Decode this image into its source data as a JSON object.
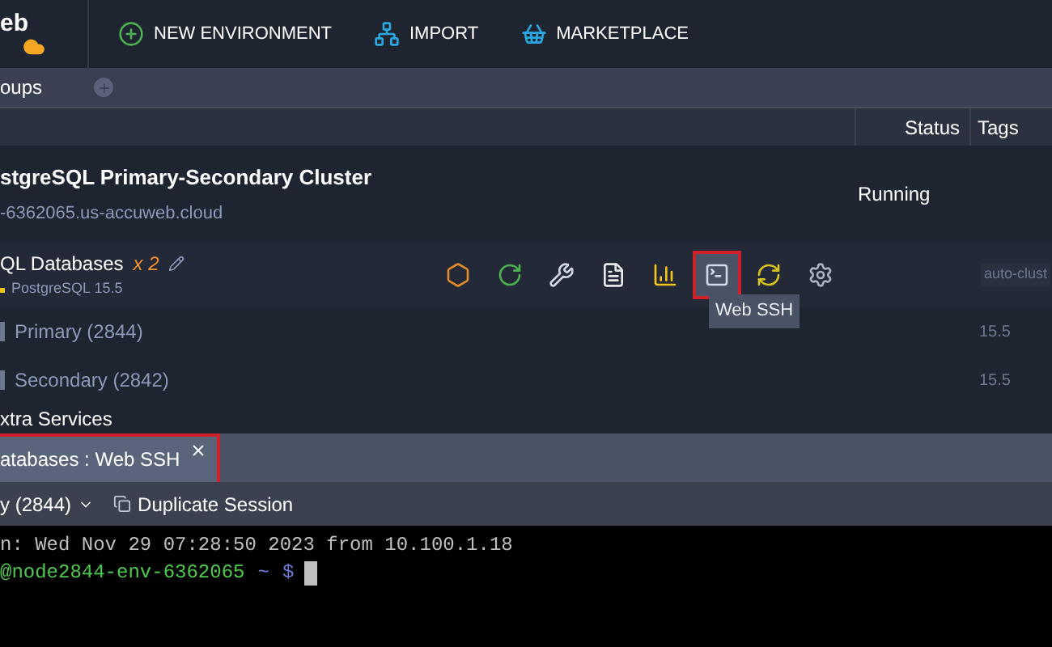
{
  "logo": {
    "text": "eb"
  },
  "toolbar": [
    {
      "kind": "new",
      "label": "NEW ENVIRONMENT"
    },
    {
      "kind": "import",
      "label": "IMPORT"
    },
    {
      "kind": "marketplace",
      "label": "MARKETPLACE"
    }
  ],
  "breadcrumb": {
    "label": "oups"
  },
  "columns": {
    "status": "Status",
    "tags": "Tags"
  },
  "environment": {
    "title": "stgreSQL Primary-Secondary Cluster",
    "domain": "-6362065.us-accuweb.cloud",
    "status": "Running"
  },
  "node_group": {
    "name": "QL Databases",
    "count": "x 2",
    "version": "PostgreSQL 15.5",
    "tag": "auto-clust",
    "actions": [
      {
        "kind": "addons",
        "highlighted": false
      },
      {
        "kind": "restart",
        "highlighted": false
      },
      {
        "kind": "config",
        "highlighted": false
      },
      {
        "kind": "log",
        "highlighted": false
      },
      {
        "kind": "stats",
        "highlighted": false
      },
      {
        "kind": "ssh",
        "highlighted": true
      },
      {
        "kind": "redeploy",
        "highlighted": false
      },
      {
        "kind": "settings",
        "highlighted": false
      }
    ],
    "tooltip": "Web SSH"
  },
  "nodes": [
    {
      "name": "Primary (2844)",
      "version": "15.5"
    },
    {
      "name": "Secondary (2842)",
      "version": "15.5"
    }
  ],
  "extra": "xtra Services",
  "ssh_panel": {
    "tab": {
      "label": "atabases : Web SSH",
      "highlighted": true
    },
    "node_select": "y (2844)",
    "duplicate": "Duplicate Session",
    "terminal": {
      "last_login": "n: Wed Nov 29 07:28:50 2023 from 10.100.1.18",
      "host": "@node2844-env-6362065",
      "path": "~",
      "prompt": "$"
    }
  }
}
